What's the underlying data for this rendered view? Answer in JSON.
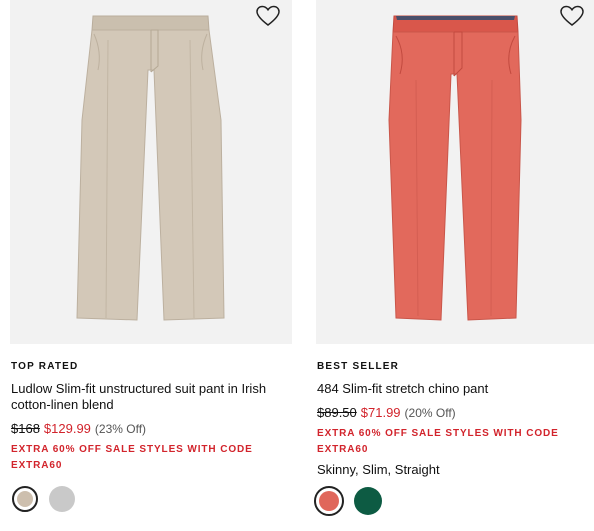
{
  "products": [
    {
      "badge": "TOP RATED",
      "name": "Ludlow Slim-fit unstructured suit pant in Irish cotton-linen blend",
      "original_price": "$168",
      "sale_price": "$129.99",
      "discount": "(23% Off)",
      "promo_line1": "EXTRA 60% OFF SALE STYLES WITH CODE",
      "promo_line2": "EXTRA60",
      "fits": "",
      "pant_color": "#cfc3b3",
      "swatches": [
        "#cdbfae",
        "#c9c9c9"
      ],
      "icon": "heart-icon"
    },
    {
      "badge": "BEST SELLER",
      "name": "484 Slim-fit stretch chino pant",
      "original_price": "$89.50",
      "sale_price": "$71.99",
      "discount": "(20% Off)",
      "promo_line1": "EXTRA 60% OFF SALE STYLES WITH CODE",
      "promo_line2": "EXTRA60",
      "fits": "Skinny, Slim, Straight",
      "pant_color": "#e2695c",
      "swatches": [
        "#e0675b",
        "#0d5b43"
      ],
      "icon": "heart-icon"
    }
  ]
}
